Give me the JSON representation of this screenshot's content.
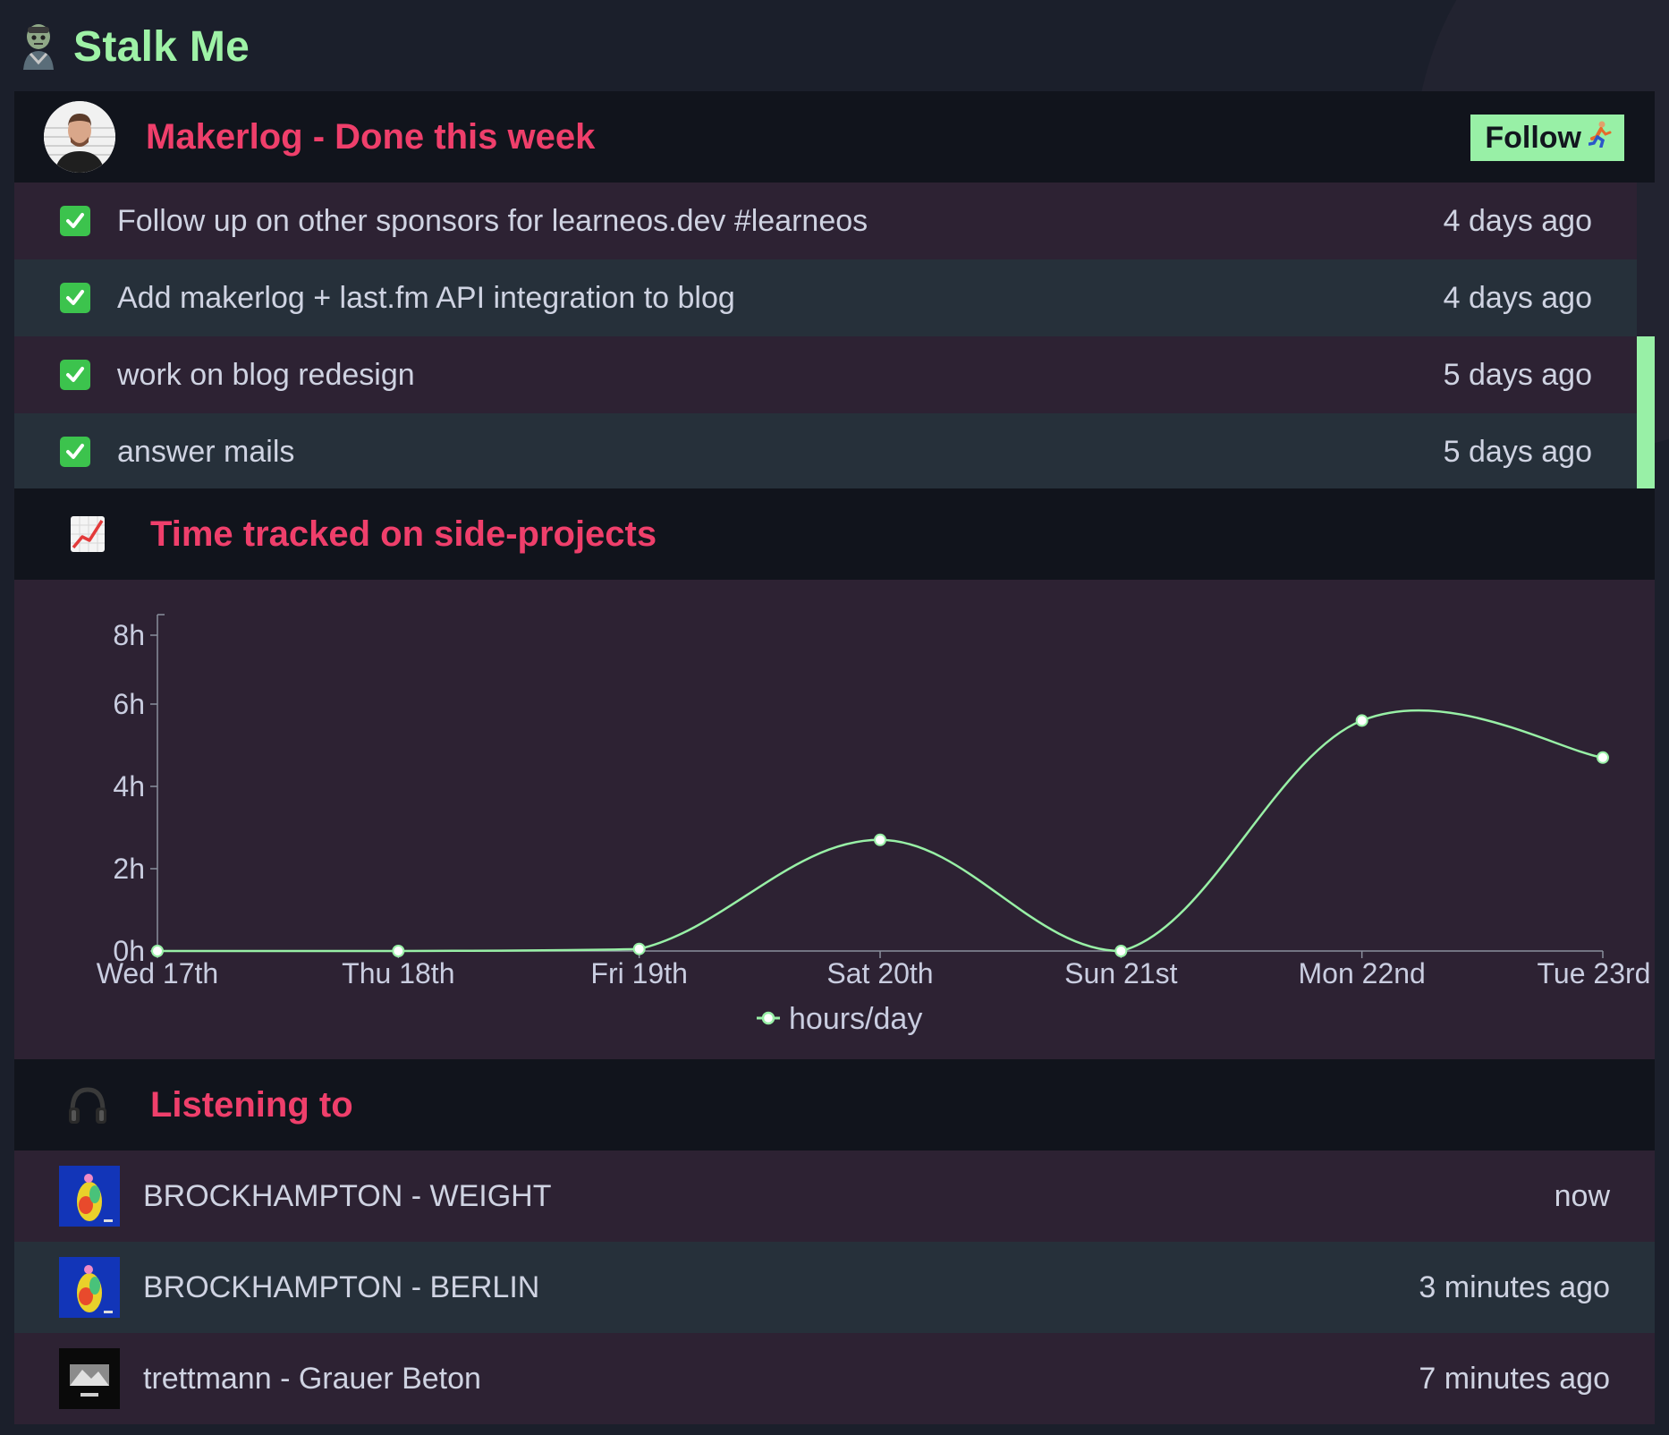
{
  "app": {
    "title": "Stalk Me",
    "logo_icon": "zombie-icon"
  },
  "colors": {
    "accent_green": "#98f0a6",
    "accent_pink": "#ef3f6b",
    "row_odd": "#2d2233",
    "row_even": "#26303a",
    "header_bg": "#11141c"
  },
  "makerlog": {
    "title": "Makerlog - Done this week",
    "follow_label": "Follow",
    "follow_icon": "runner-icon",
    "tasks": [
      {
        "text": "Follow up on other sponsors for learneos.dev #learneos",
        "time": "4 days ago"
      },
      {
        "text": "Add makerlog + last.fm API integration to blog",
        "time": "4 days ago"
      },
      {
        "text": "work on blog redesign",
        "time": "5 days ago"
      },
      {
        "text": "answer mails",
        "time": "5 days ago"
      }
    ]
  },
  "time_tracked": {
    "title": "Time tracked on side-projects",
    "icon": "chart-increasing-icon"
  },
  "chart_data": {
    "type": "line",
    "categories": [
      "Wed 17th",
      "Thu 18th",
      "Fri 19th",
      "Sat 20th",
      "Sun 21st",
      "Mon 22nd",
      "Tue 23rd"
    ],
    "series": [
      {
        "name": "hours/day",
        "values": [
          0,
          0,
          0.05,
          2.7,
          0,
          5.6,
          4.7
        ]
      }
    ],
    "y_ticks": [
      "0h",
      "2h",
      "4h",
      "6h",
      "8h"
    ],
    "ylim": [
      0,
      8
    ],
    "legend_position": "bottom",
    "line_color": "#98f0a6"
  },
  "listening": {
    "title": "Listening to",
    "icon": "headphones-icon",
    "tracks": [
      {
        "text": "BROCKHAMPTON - WEIGHT",
        "time": "now",
        "cover": "colorful"
      },
      {
        "text": "BROCKHAMPTON - BERLIN",
        "time": "3 minutes ago",
        "cover": "colorful"
      },
      {
        "text": "trettmann - Grauer Beton",
        "time": "7 minutes ago",
        "cover": "mono"
      }
    ]
  }
}
